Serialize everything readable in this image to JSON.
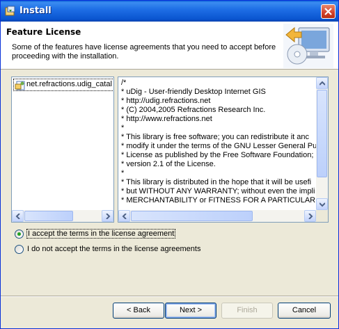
{
  "window": {
    "title": "Install"
  },
  "header": {
    "title": "Feature License",
    "description": "Some of the features have license agreements that you need to accept before proceeding with the installation."
  },
  "features": {
    "items": [
      {
        "label": "net.refractions.udig_catal"
      }
    ]
  },
  "license": {
    "text": "/*\n* uDig - User-friendly Desktop Internet GIS\n* http://udig.refractions.net\n* (C) 2004,2005 Refractions Research Inc.\n* http://www.refractions.net\n*\n* This library is free software; you can redistribute it anc\n* modify it under the terms of the GNU Lesser General Pu\n* License as published by the Free Software Foundation;\n* version 2.1 of the License.\n*\n* This library is distributed in the hope that it will be usefi\n* but WITHOUT ANY WARRANTY; without even the impli\n* MERCHANTABILITY or FITNESS FOR A PARTICULAR Pu"
  },
  "options": {
    "accept_label": "I accept the terms in the license agreement",
    "decline_label": "I do not accept the terms in the license agreements",
    "selected": "accept"
  },
  "buttons": {
    "back": "< Back",
    "next": "Next >",
    "finish": "Finish",
    "cancel": "Cancel"
  },
  "colors": {
    "title_bar": "#0a55d0",
    "accent_check": "#21a121",
    "disabled_text": "#aca899"
  },
  "icons": [
    "install-icon",
    "close-icon",
    "wizard-computer-icon",
    "feature-icon"
  ]
}
